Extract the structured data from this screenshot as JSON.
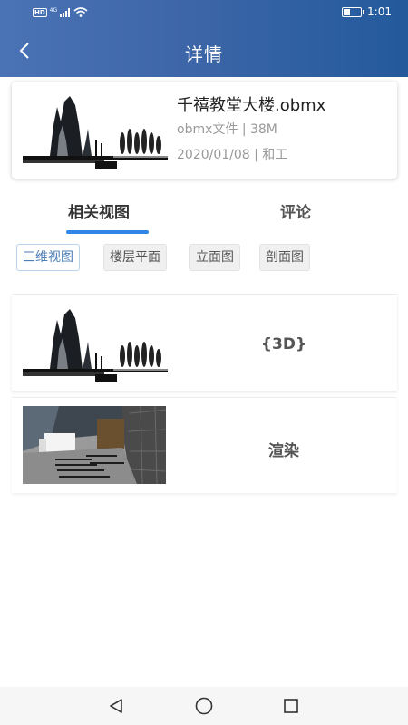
{
  "status_bar": {
    "hd": "HD",
    "net": "4G",
    "time": "1:01"
  },
  "header": {
    "title": "详情"
  },
  "file": {
    "name": "千禧教堂大楼.obmx",
    "meta": "obmx文件 | 38M",
    "date": "2020/01/08 | 和工"
  },
  "tabs": [
    {
      "label": "相关视图"
    },
    {
      "label": "评论"
    }
  ],
  "filters": [
    {
      "label": "三维视图"
    },
    {
      "label": "楼层平面"
    },
    {
      "label": "立面图"
    },
    {
      "label": "剖面图"
    }
  ],
  "results": [
    {
      "label": "{3D}"
    },
    {
      "label": "渲染"
    }
  ],
  "colors": {
    "header_start": "#4a73b6",
    "header_end": "#235a9c",
    "tab_indicator": "#2f86e6",
    "chip_active_text": "#4a7db4"
  }
}
